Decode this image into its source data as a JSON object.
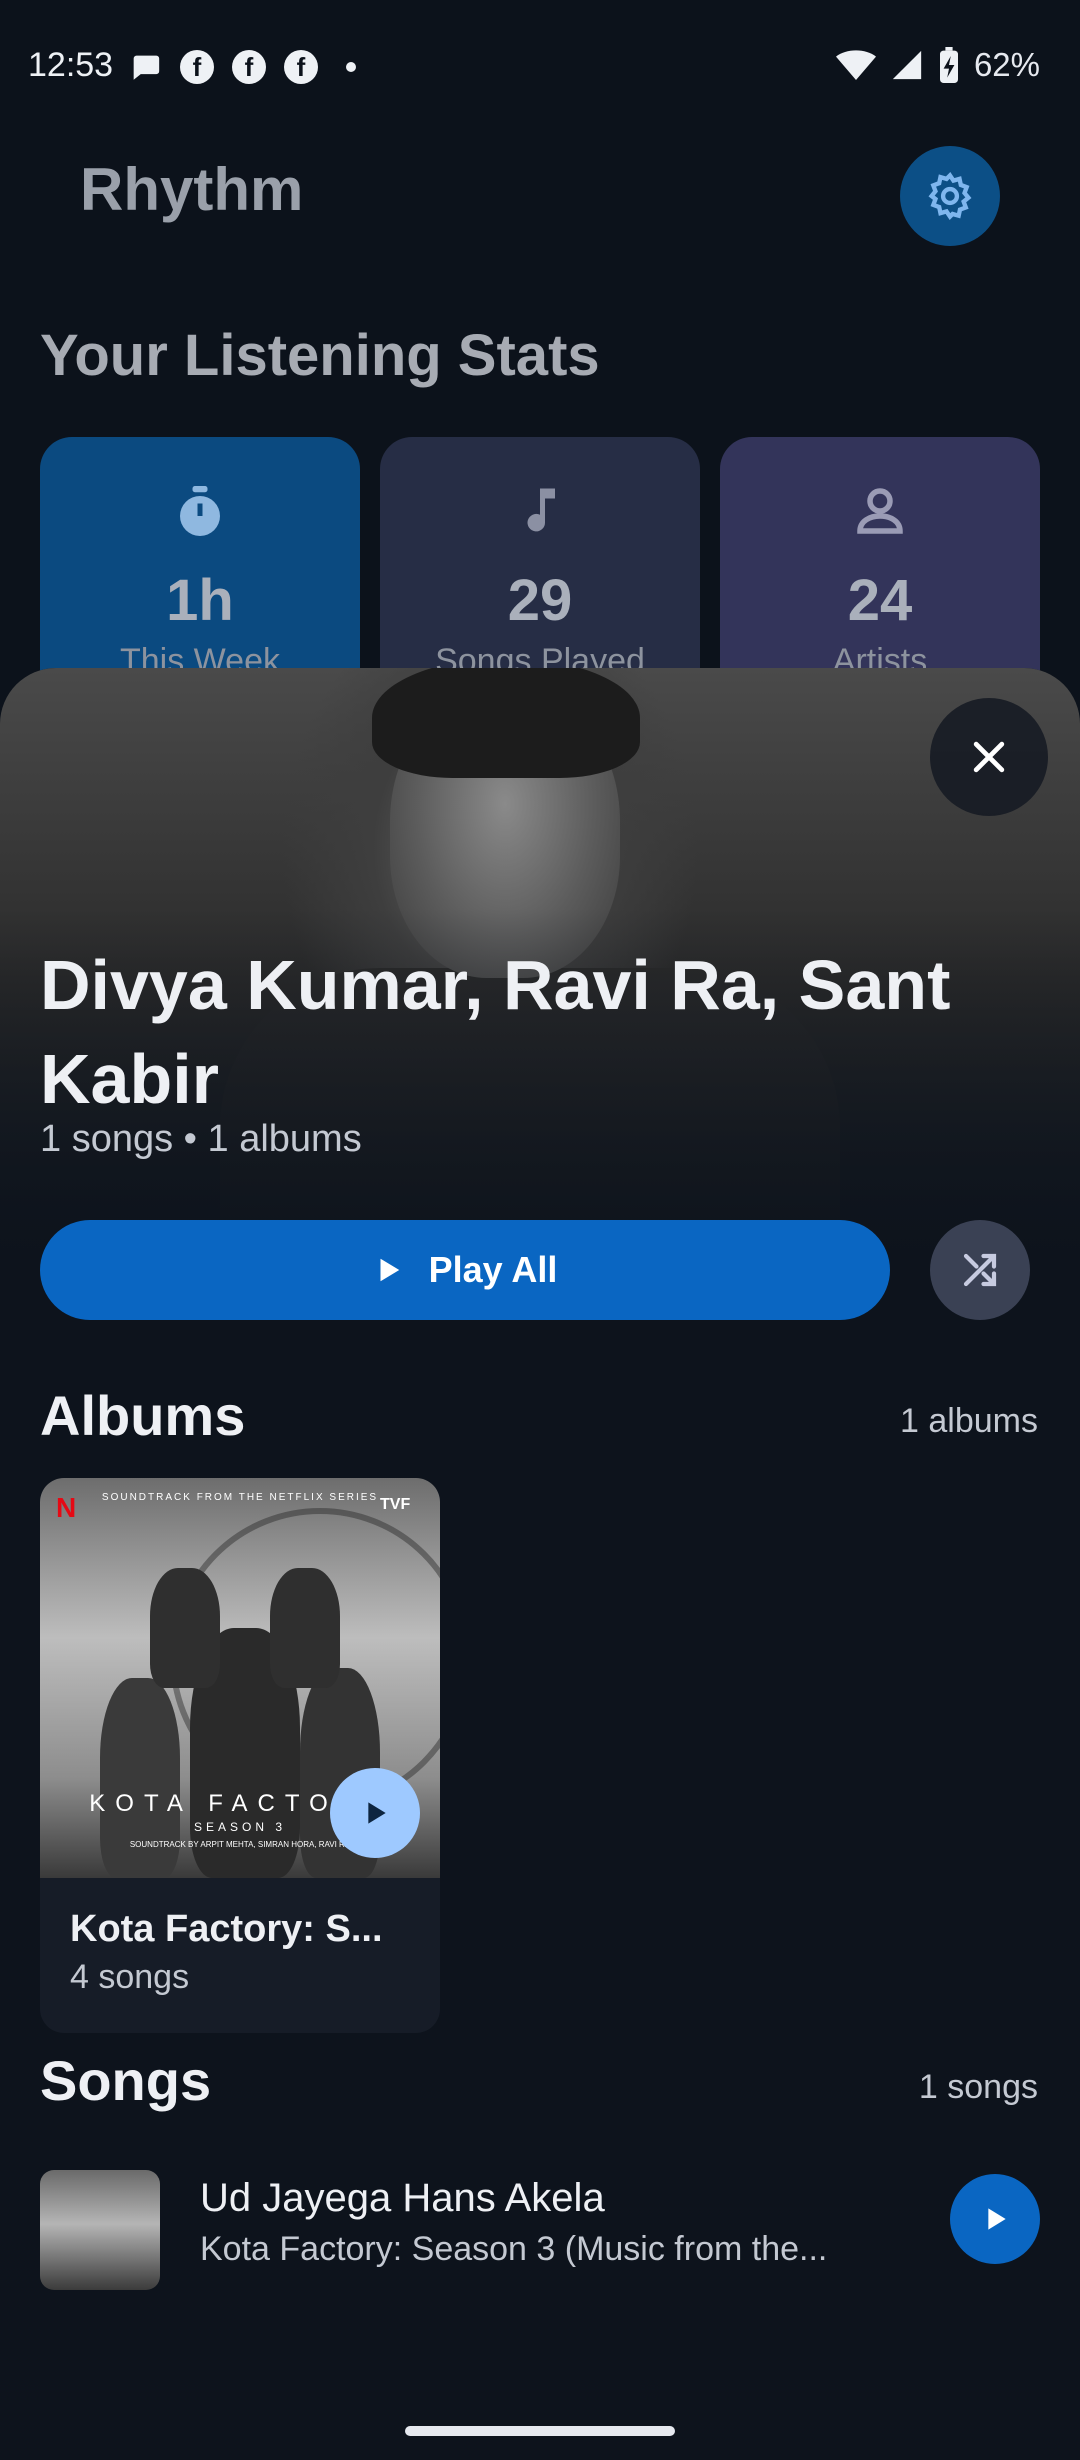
{
  "status_bar": {
    "time": "12:53",
    "battery": "62%",
    "notification_icons": [
      "chat-icon",
      "facebook-icon",
      "facebook-icon",
      "facebook-icon",
      "dot-icon"
    ]
  },
  "home": {
    "app_title": "Rhythm",
    "stats_title": "Your Listening Stats",
    "stats": [
      {
        "icon": "timer-icon",
        "value": "1h",
        "label": "This Week",
        "bg": "#0b4a80"
      },
      {
        "icon": "music-note-icon",
        "value": "29",
        "label": "Songs Played",
        "bg": "#262d45"
      },
      {
        "icon": "person-icon",
        "value": "24",
        "label": "Artists",
        "bg": "#33345a"
      }
    ]
  },
  "artist_sheet": {
    "name": "Divya Kumar, Ravi Ra, Sant Kabir",
    "meta": "1 songs • 1 albums",
    "play_all_label": "Play All",
    "albums_section": {
      "title": "Albums",
      "count": "1 albums",
      "items": [
        {
          "title": "Kota Factory: S...",
          "subtitle": "4 songs",
          "art_text": {
            "top": "SOUNDTRACK FROM THE NETFLIX SERIES",
            "main": "KOTA FACTORY",
            "season": "SEASON 3",
            "credits": "SOUNDTRACK BY ARPIT MEHTA, SIMRAN HORA, RAVI RA",
            "netflix": "N",
            "tvf": "TVF"
          }
        }
      ]
    },
    "songs_section": {
      "title": "Songs",
      "count": "1 songs",
      "items": [
        {
          "title": "Ud Jayega Hans Akela",
          "subtitle": "Kota Factory: Season 3 (Music from the..."
        }
      ]
    }
  },
  "colors": {
    "accent": "#0a66c2",
    "background": "#0c121b",
    "album_play": "#9ec9ff"
  }
}
